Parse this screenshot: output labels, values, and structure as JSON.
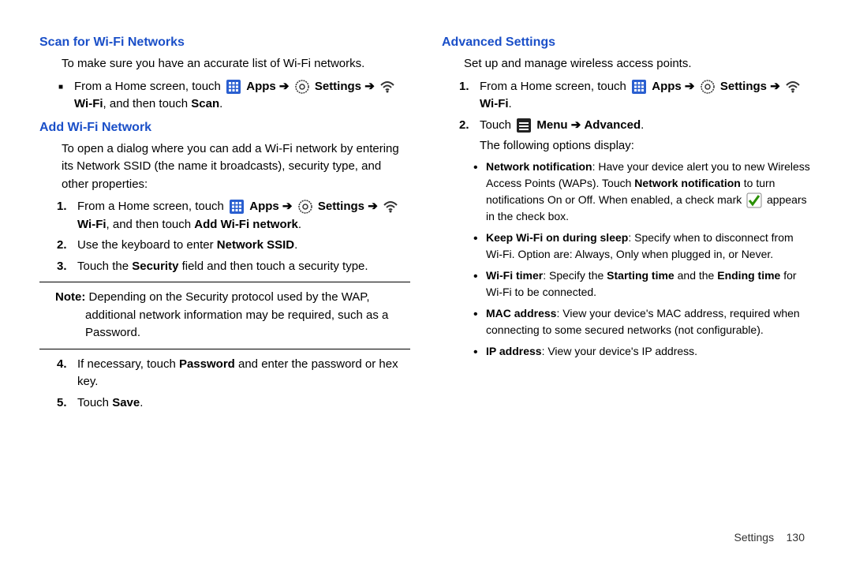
{
  "left": {
    "scan_title": "Scan for Wi-Fi Networks",
    "scan_intro": "To make sure you have an accurate list of Wi-Fi networks.",
    "scan_step_a": "From a Home screen, touch ",
    "apps": "Apps",
    "settings": "Settings",
    "wifi": "Wi-Fi",
    "scan_step_b": ", and then touch ",
    "scan_word": "Scan",
    "add_title": "Add Wi-Fi Network",
    "add_intro": "To open a dialog where you can add a Wi-Fi network by entering its Network SSID (the name it broadcasts), security type, and other properties:",
    "add_1a": "From a Home screen, touch ",
    "add_1b": ", and then touch ",
    "add_1c": "Add Wi-Fi network",
    "add_2a": "Use the keyboard to enter ",
    "add_2b": "Network SSID",
    "add_3a": "Touch the ",
    "add_3b": "Security",
    "add_3c": " field and then touch a security type.",
    "note_label": "Note:",
    "note_text": " Depending on the Security protocol used by the WAP, additional network information may be required, such as a Password.",
    "add_4a": "If necessary, touch ",
    "add_4b": "Password",
    "add_4c": " and enter the password or hex key.",
    "add_5a": "Touch ",
    "add_5b": "Save"
  },
  "right": {
    "adv_title": "Advanced Settings",
    "adv_intro": "Set up and manage wireless access points.",
    "adv_1a": "From a Home screen, touch ",
    "adv_2a": "Touch ",
    "menu": "Menu",
    "advanced": "Advanced",
    "adv_2b": "The following options display:",
    "b1_a": "Network notification",
    "b1_b": ": Have your device alert you to new Wireless Access Points (WAPs). Touch ",
    "b1_c": "Network notification",
    "b1_d": " to turn notifications On or Off. When enabled, a check mark ",
    "b1_e": " appears in the check box.",
    "b2_a": "Keep Wi-Fi on during sleep",
    "b2_b": ": Specify when to disconnect from Wi-Fi. Option are: Always, Only when plugged in, or Never.",
    "b3_a": "Wi-Fi timer",
    "b3_b": ": Specify the ",
    "b3_c": "Starting time",
    "b3_d": " and the ",
    "b3_e": "Ending time",
    "b3_f": " for Wi-Fi to be connected.",
    "b4_a": "MAC address",
    "b4_b": ": View your device's MAC address, required when connecting to some secured networks (not configurable).",
    "b5_a": "IP address",
    "b5_b": ": View your device's IP address."
  },
  "footer_label": "Settings",
  "footer_page": "130"
}
